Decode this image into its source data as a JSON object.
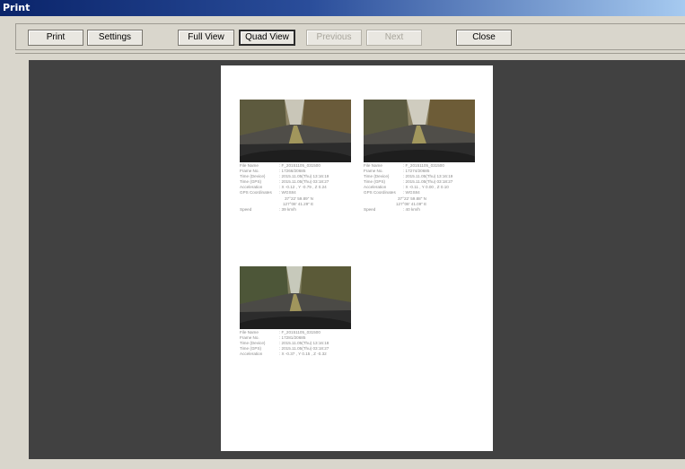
{
  "window": {
    "title": "Print"
  },
  "toolbar": {
    "print": "Print",
    "settings": "Settings",
    "full_view": "Full View",
    "quad_view": "Quad View",
    "previous": "Previous",
    "next": "Next",
    "close": "Close"
  },
  "cards": [
    {
      "file_name_label": "File Name",
      "file_name": ": F_20151105_031500",
      "frame_label": "Frame No.",
      "frame": ": 17266/20685",
      "time_device_label": "Time (Device)",
      "time_device": ": 2015.11.05(Thu)  13:16:19",
      "time_gps_label": "Time (GPS)",
      "time_gps": ": 2015.11.05(Thu)  03:18:27",
      "accel_label": "Acceleration",
      "accel": ": X -0.12 , Y -0.79 , Z 0.24",
      "gps_label": "GPS Coordinates",
      "gps": ": WGS84",
      "lat": "37°22' 59.89\" N",
      "lon": "127°08' 41.29\" E",
      "speed_label": "Speed",
      "speed": ": 39 km/h"
    },
    {
      "file_name_label": "File Name",
      "file_name": ": F_20151105_031500",
      "frame_label": "Frame No.",
      "frame": ": 17274/20685",
      "time_device_label": "Time (Device)",
      "time_device": ": 2015.11.05(Thu)  13:16:19",
      "time_gps_label": "Time (GPS)",
      "time_gps": ": 2015.11.05(Thu)  03:18:27",
      "accel_label": "Acceleration",
      "accel": ": X -0.11 , Y 0.00 , Z 0.10",
      "gps_label": "GPS Coordinates",
      "gps": ": WGS84",
      "lat": "37°22' 59.88\" N",
      "lon": "127°08' 41.09\" E",
      "speed_label": "Speed",
      "speed": ": 40 km/h"
    },
    {
      "file_name_label": "File Name",
      "file_name": ": F_20151105_031500",
      "frame_label": "Frame No.",
      "frame": ": 17281/20685",
      "time_device_label": "Time (Device)",
      "time_device": ": 2015.11.05(Thu)  13:16:18",
      "time_gps_label": "Time (GPS)",
      "time_gps": ": 2015.11.05(Thu)  03:18:27",
      "accel_label": "Acceleration",
      "accel": ": X -0.37 , Y 0.15 , Z -0.32"
    }
  ]
}
